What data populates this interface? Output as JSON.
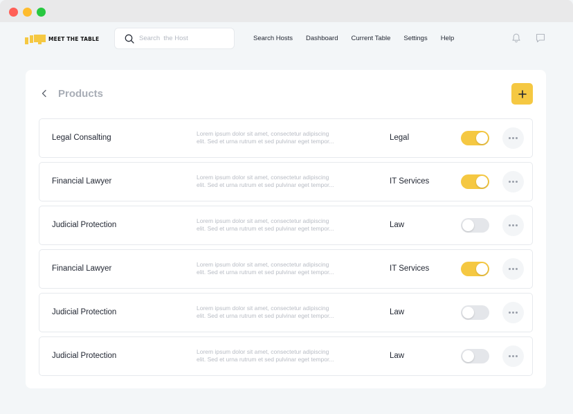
{
  "brand": {
    "name": "MEET THE TABLE",
    "accent": "#f5c842"
  },
  "search": {
    "placeholder": "Search  the Host",
    "value": ""
  },
  "nav": [
    "Search Hosts",
    "Dashboard",
    "Current Table",
    "Settings",
    "Help"
  ],
  "page": {
    "title": "Products"
  },
  "products": [
    {
      "name": "Legal Consalting",
      "desc1": "Lorem ipsum dolor sit amet, consectetur adipiscing",
      "desc2": "elit. Sed et urna rutrum et sed pulvinar eget tempor...",
      "category": "Legal",
      "enabled": true
    },
    {
      "name": "Financial Lawyer",
      "desc1": "Lorem ipsum dolor sit amet, consectetur adipiscing",
      "desc2": "elit. Sed et urna rutrum et sed pulvinar eget tempor...",
      "category": "IT Services",
      "enabled": true
    },
    {
      "name": "Judicial Protection",
      "desc1": "Lorem ipsum dolor sit amet, consectetur adipiscing",
      "desc2": "elit. Sed et urna rutrum et sed pulvinar eget tempor...",
      "category": "Law",
      "enabled": false
    },
    {
      "name": "Financial Lawyer",
      "desc1": "Lorem ipsum dolor sit amet, consectetur adipiscing",
      "desc2": "elit. Sed et urna rutrum et sed pulvinar eget tempor...",
      "category": "IT Services",
      "enabled": true
    },
    {
      "name": "Judicial Protection",
      "desc1": "Lorem ipsum dolor sit amet, consectetur adipiscing",
      "desc2": "elit. Sed et urna rutrum et sed pulvinar eget tempor...",
      "category": "Law",
      "enabled": false
    },
    {
      "name": "Judicial Protection",
      "desc1": "Lorem ipsum dolor sit amet, consectetur adipiscing",
      "desc2": "elit. Sed et urna rutrum et sed pulvinar eget tempor...",
      "category": "Law",
      "enabled": false
    }
  ],
  "icons": {
    "search": "search-icon",
    "bell": "bell-icon",
    "chat": "chat-icon",
    "back": "chevron-left-icon",
    "add": "plus-icon",
    "more": "more-horizontal-icon"
  }
}
